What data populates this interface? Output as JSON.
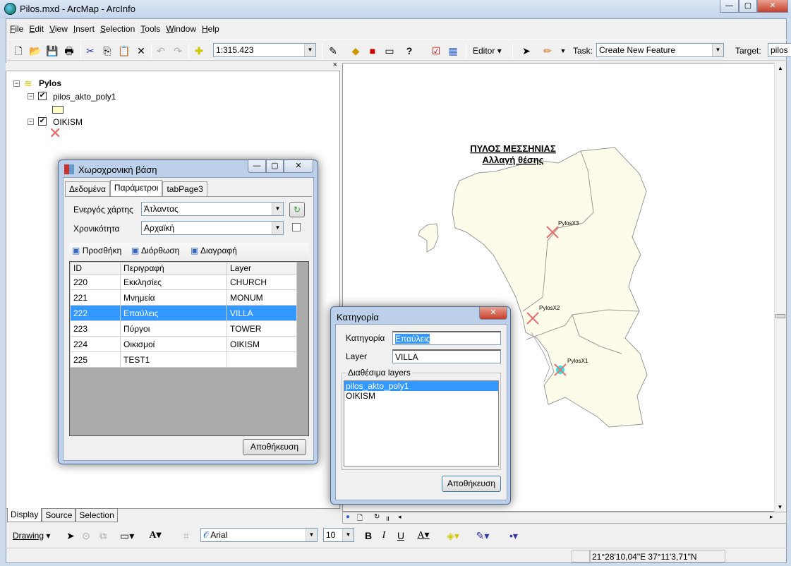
{
  "window": {
    "title": "Pilos.mxd - ArcMap - ArcInfo"
  },
  "menu": [
    {
      "u": "F",
      "rest": "ile"
    },
    {
      "u": "E",
      "rest": "dit"
    },
    {
      "u": "V",
      "rest": "iew"
    },
    {
      "u": "I",
      "rest": "nsert"
    },
    {
      "u": "S",
      "rest": "election"
    },
    {
      "u": "T",
      "rest": "ools"
    },
    {
      "u": "W",
      "rest": "indow"
    },
    {
      "u": "H",
      "rest": "elp"
    }
  ],
  "toolbar": {
    "scale": "1:315.423",
    "editor": "Editor",
    "task_label": "Task:",
    "task": "Create New Feature",
    "target_label": "Target:",
    "target": "pilos"
  },
  "toc": {
    "dataframe": "Pylos",
    "layers": [
      {
        "name": "pilos_akto_poly1",
        "checked": true,
        "symbol_color": "#fefcc8"
      },
      {
        "name": "OIKISM",
        "checked": true,
        "symbol_color": "#ee7777"
      }
    ]
  },
  "toc_tabs": [
    "Display",
    "Source",
    "Selection"
  ],
  "map": {
    "title1": "ΠΥΛΟΣ ΜΕΣΣΗΝΙΑΣ",
    "title2": "Αλλαγή θέσης",
    "points": [
      "PylosX3",
      "PylosX2",
      "PylosX1"
    ],
    "land_color": "#fdfcea"
  },
  "dialog1": {
    "title": "Χωροχρονική βάση",
    "tabs": [
      "Δεδομένα",
      "Παράμετροι",
      "tabPage3"
    ],
    "active_tab": "Παράμετροι",
    "map_label": "Ενεργός χάρτης",
    "map_value": "Άτλαντας",
    "period_label": "Χρονικότητα",
    "period_value": "Αρχαϊκή",
    "actions": [
      "Προσθήκη",
      "Διόρθωση",
      "Διαγραφή"
    ],
    "columns": [
      "ID",
      "Περιγραφή",
      "Layer"
    ],
    "rows": [
      [
        "220",
        "Εκκλησίες",
        "CHURCH"
      ],
      [
        "221",
        "Μνημεία",
        "MONUM"
      ],
      [
        "222",
        "Επαύλεις",
        "VILLA"
      ],
      [
        "223",
        "Πύργοι",
        "TOWER"
      ],
      [
        "224",
        "Οικισμοί",
        "OIKISM"
      ],
      [
        "225",
        "TEST1",
        ""
      ]
    ],
    "selected_row": 2,
    "save": "Αποθήκευση"
  },
  "dialog2": {
    "title": "Κατηγορία",
    "cat_label": "Κατηγορία",
    "cat_value": "Επαύλεις",
    "layer_label": "Layer",
    "layer_value": "VILLA",
    "group": "Διαθέσιμα layers",
    "list": [
      "pilos_akto_poly1",
      "OIKISM"
    ],
    "selected": 0,
    "save": "Αποθήκευση"
  },
  "drawing": {
    "label": "Drawing",
    "font": "Arial",
    "size": "10",
    "bold": "B",
    "italic": "I",
    "underline": "U"
  },
  "status": {
    "coords": "21°28'10,04\"E  37°11'3,71\"N"
  }
}
